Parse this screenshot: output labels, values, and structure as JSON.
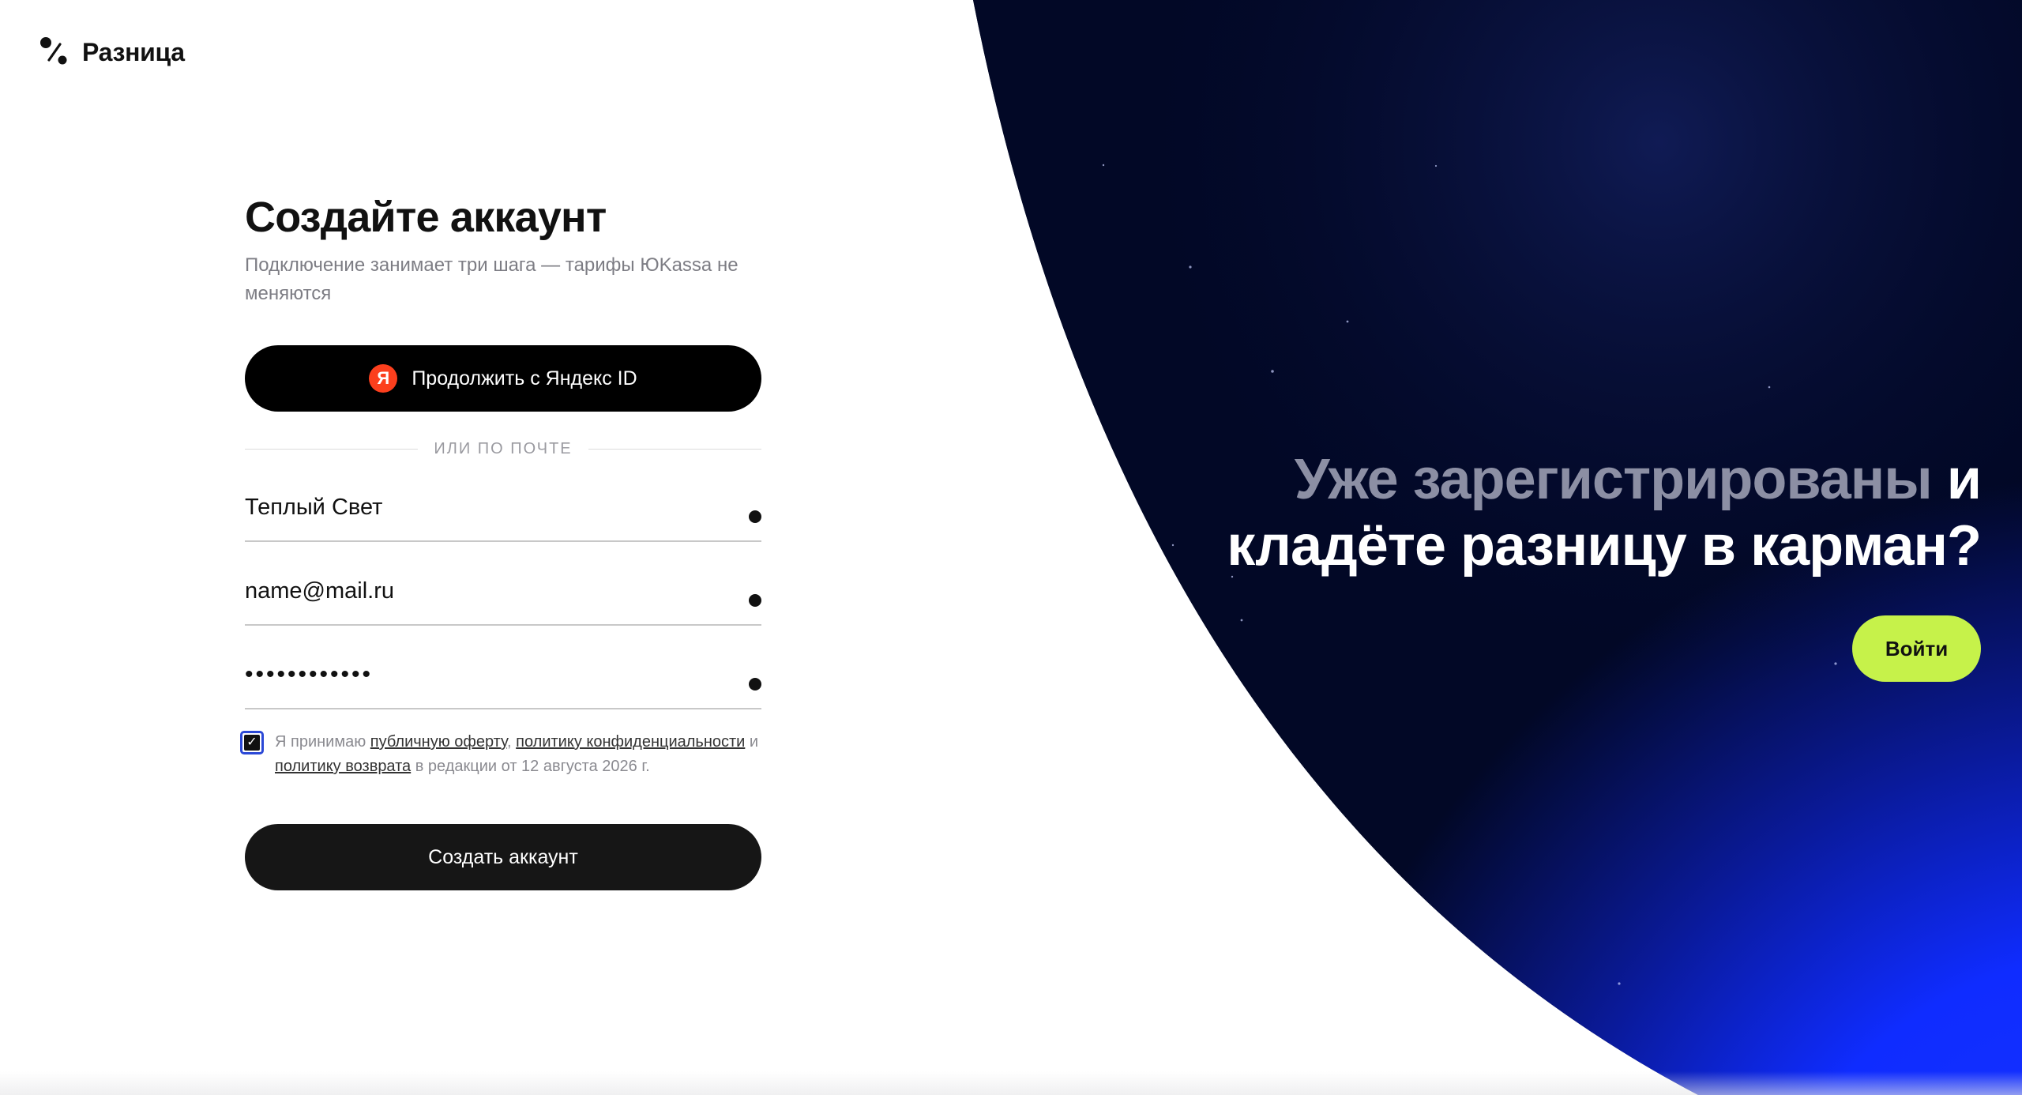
{
  "brand": {
    "name": "Разница",
    "logo_icon": "percent-logo-icon"
  },
  "form": {
    "title": "Создайте аккаунт",
    "subtitle": "Подключение занимает три шага — тарифы ЮKassa не меняются",
    "yandex_button_label": "Продолжить с Яндекс ID",
    "yandex_icon_letter": "Я",
    "divider_text": "ИЛИ ПО ПОЧТЕ",
    "fields": {
      "name_value": "Теплый Свет",
      "email_value": "name@mail.ru",
      "password_value": "••••••••••••"
    },
    "consent": {
      "checked": true,
      "prefix": "Я принимаю",
      "link_offer": "публичную оферту",
      "sep1": ",",
      "link_privacy": "политику конфиденциальности",
      "and": "и",
      "link_refund": "политику возврата",
      "suffix": "в редакции от 12 августа 2026 г."
    },
    "submit_label": "Создать аккаунт"
  },
  "hero": {
    "headline_muted": "Уже зарегистрированы",
    "headline_main_1": "и",
    "headline_main_2": "кладёте разницу в карман?",
    "login_label": "Войти"
  },
  "colors": {
    "accent_green": "#c6f24a",
    "dark_navy": "#020826",
    "bright_blue": "#0f2cff",
    "yandex_red": "#fc3f1d"
  }
}
